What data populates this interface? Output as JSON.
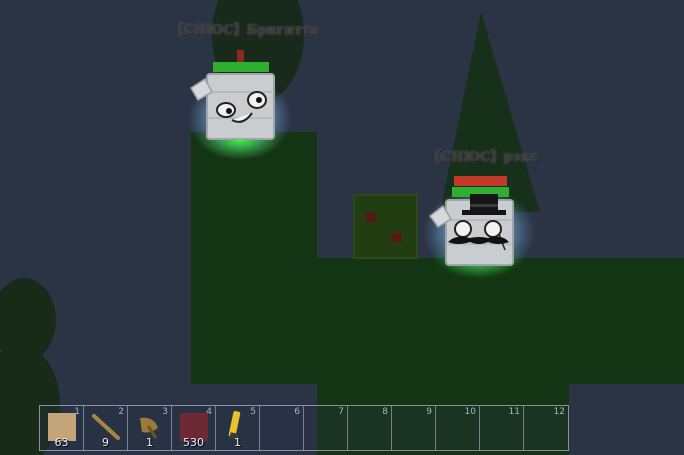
{
  "players": [
    {
      "name": "【СНЮС】Бригитта",
      "health": 1.0
    },
    {
      "name": "【СНЮС】рэкс",
      "health": 1.0
    }
  ],
  "hotbar": {
    "slots": [
      {
        "number": "1",
        "count": "63",
        "item": "wood-block-icon"
      },
      {
        "number": "2",
        "count": "9",
        "item": "stick-icon"
      },
      {
        "number": "3",
        "count": "1",
        "item": "axe-icon"
      },
      {
        "number": "4",
        "count": "530",
        "item": "red-block-icon"
      },
      {
        "number": "5",
        "count": "1",
        "item": "yellow-tool-icon"
      },
      {
        "number": "6",
        "count": "",
        "item": ""
      },
      {
        "number": "7",
        "count": "",
        "item": ""
      },
      {
        "number": "8",
        "count": "",
        "item": ""
      },
      {
        "number": "9",
        "count": "",
        "item": ""
      },
      {
        "number": "10",
        "count": "",
        "item": ""
      },
      {
        "number": "11",
        "count": "",
        "item": ""
      },
      {
        "number": "12",
        "count": "",
        "item": ""
      }
    ]
  },
  "colors": {
    "sky": "#2a3445",
    "grass": "#133513",
    "health_green": "#2fae2f",
    "health_red": "#c0392b",
    "player_glow": "#bfe3ff"
  }
}
